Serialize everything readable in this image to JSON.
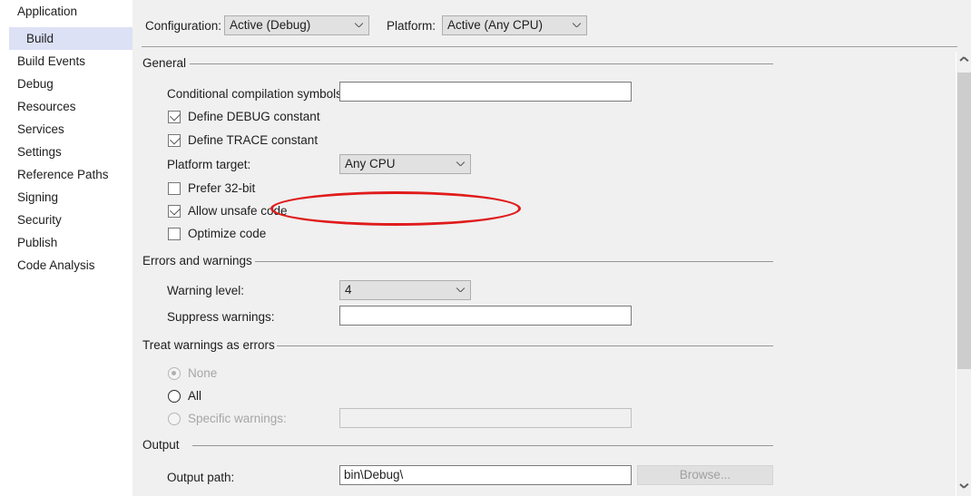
{
  "sidebar": {
    "items": [
      {
        "label": "Application",
        "selected": false
      },
      {
        "label": "Build",
        "selected": true
      },
      {
        "label": "Build Events",
        "selected": false
      },
      {
        "label": "Debug",
        "selected": false
      },
      {
        "label": "Resources",
        "selected": false
      },
      {
        "label": "Services",
        "selected": false
      },
      {
        "label": "Settings",
        "selected": false
      },
      {
        "label": "Reference Paths",
        "selected": false
      },
      {
        "label": "Signing",
        "selected": false
      },
      {
        "label": "Security",
        "selected": false
      },
      {
        "label": "Publish",
        "selected": false
      },
      {
        "label": "Code Analysis",
        "selected": false
      }
    ]
  },
  "configbar": {
    "configuration_label": "Configuration:",
    "configuration_value": "Active (Debug)",
    "platform_label": "Platform:",
    "platform_value": "Active (Any CPU)"
  },
  "general": {
    "title": "General",
    "conditional_symbols_label": "Conditional compilation symbols:",
    "conditional_symbols_value": "",
    "define_debug_label": "Define DEBUG constant",
    "define_debug_checked": true,
    "define_trace_label": "Define TRACE constant",
    "define_trace_checked": true,
    "platform_target_label": "Platform target:",
    "platform_target_value": "Any CPU",
    "prefer32_label": "Prefer 32-bit",
    "prefer32_checked": false,
    "allow_unsafe_label": "Allow unsafe code",
    "allow_unsafe_checked": true,
    "optimize_label": "Optimize code",
    "optimize_checked": false
  },
  "errors_warnings": {
    "title": "Errors and warnings",
    "warning_level_label": "Warning level:",
    "warning_level_value": "4",
    "suppress_warnings_label": "Suppress warnings:",
    "suppress_warnings_value": ""
  },
  "treat_warnings": {
    "title": "Treat warnings as errors",
    "none_label": "None",
    "none_selected": true,
    "none_enabled": false,
    "all_label": "All",
    "all_selected": false,
    "all_enabled": true,
    "specific_label": "Specific warnings:",
    "specific_selected": false,
    "specific_enabled": false,
    "specific_value": ""
  },
  "output": {
    "title": "Output",
    "output_path_label": "Output path:",
    "output_path_value": "bin\\Debug\\",
    "browse_label": "Browse...",
    "browse_enabled": false
  },
  "annotation": {
    "shape": "ellipse",
    "color": "#e01b1b",
    "targets": "Allow unsafe code"
  },
  "scrollbar": {
    "up_icon": "chevron-up-icon",
    "down_icon": "chevron-down-icon"
  }
}
